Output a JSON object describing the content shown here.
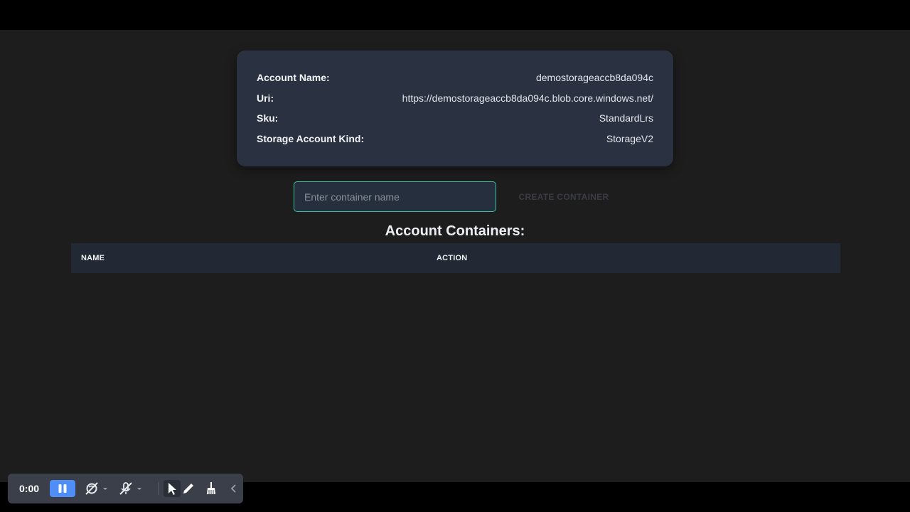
{
  "account": {
    "rows": [
      {
        "key": "Account Name:",
        "value": "demostorageaccb8da094c"
      },
      {
        "key": "Uri:",
        "value": "https://demostorageaccb8da094c.blob.core.windows.net/"
      },
      {
        "key": "Sku:",
        "value": "StandardLrs"
      },
      {
        "key": "Storage Account Kind:",
        "value": "StorageV2"
      }
    ]
  },
  "create": {
    "placeholder": "Enter container name",
    "value": "",
    "button_label": "CREATE CONTAINER"
  },
  "containers": {
    "title": "Account Containers:",
    "columns": [
      "NAME",
      "ACTION"
    ],
    "rows": []
  },
  "recorder": {
    "time": "0:00",
    "icons": [
      "pause-icon",
      "camera-off-icon",
      "mic-off-icon",
      "pointer-icon",
      "pen-icon",
      "broom-icon",
      "chevron-left-icon"
    ]
  },
  "colors": {
    "accent": "#4f8ef7",
    "input_border": "#3fbf9c",
    "card_bg": "#2a3140",
    "page_bg": "#1d1d1e"
  }
}
